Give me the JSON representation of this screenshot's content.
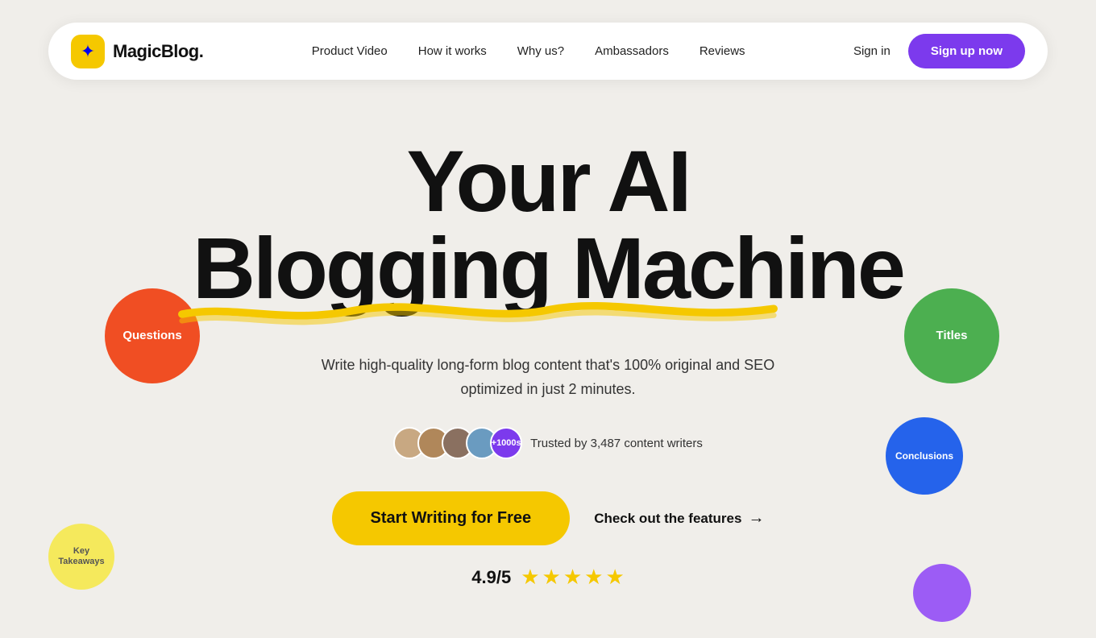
{
  "nav": {
    "logo_text": "MagicBlog.",
    "logo_icon": "✦",
    "links": [
      {
        "label": "Product Video",
        "id": "product-video"
      },
      {
        "label": "How it works",
        "id": "how-it-works"
      },
      {
        "label": "Why us?",
        "id": "why-us"
      },
      {
        "label": "Ambassadors",
        "id": "ambassadors"
      },
      {
        "label": "Reviews",
        "id": "reviews"
      }
    ],
    "sign_in_label": "Sign in",
    "sign_up_label": "Sign up now"
  },
  "hero": {
    "title_line1": "Your AI",
    "title_line2": "Blogging Machine",
    "subtitle": "Write high-quality long-form blog content that's 100% original and SEO optimized in just 2 minutes.",
    "avatars_plus": "+1000s",
    "trusted_text": "Trusted by 3,487 content writers",
    "cta_label": "Start Writing for Free",
    "check_features_label": "Check out the features",
    "rating_score": "4.9/5",
    "stars": [
      "★",
      "★",
      "★",
      "★",
      "★"
    ]
  },
  "bubbles": {
    "questions": "Questions",
    "titles": "Titles",
    "conclusions": "Conclusions",
    "key_takeaways_line1": "Key",
    "key_takeaways_line2": "Takeaways"
  }
}
